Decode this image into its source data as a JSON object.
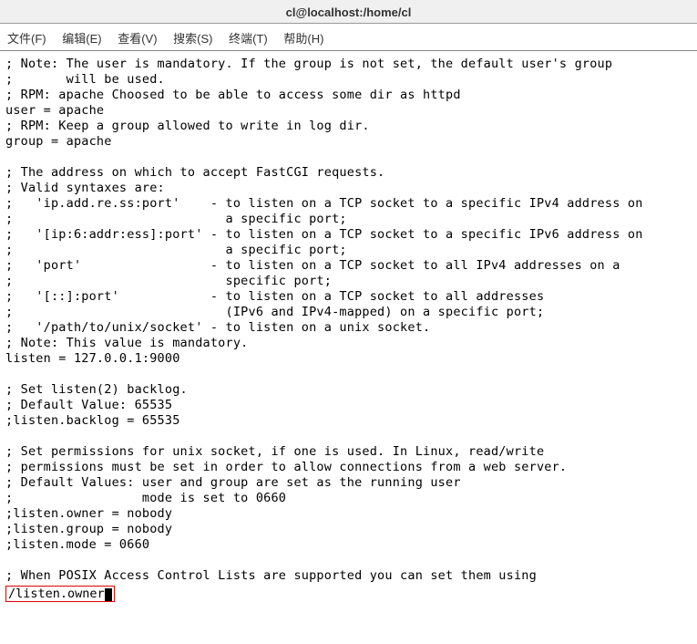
{
  "window": {
    "title": "cl@localhost:/home/cl"
  },
  "menubar": {
    "file": "文件(F)",
    "edit": "编辑(E)",
    "view": "查看(V)",
    "search": "搜索(S)",
    "terminal": "终端(T)",
    "help": "帮助(H)"
  },
  "terminal": {
    "content": "; Note: The user is mandatory. If the group is not set, the default user's group\n;       will be used.\n; RPM: apache Choosed to be able to access some dir as httpd\nuser = apache\n; RPM: Keep a group allowed to write in log dir.\ngroup = apache\n\n; The address on which to accept FastCGI requests.\n; Valid syntaxes are:\n;   'ip.add.re.ss:port'    - to listen on a TCP socket to a specific IPv4 address on\n;                            a specific port;\n;   '[ip:6:addr:ess]:port' - to listen on a TCP socket to a specific IPv6 address on\n;                            a specific port;\n;   'port'                 - to listen on a TCP socket to all IPv4 addresses on a\n;                            specific port;\n;   '[::]:port'            - to listen on a TCP socket to all addresses\n;                            (IPv6 and IPv4-mapped) on a specific port;\n;   '/path/to/unix/socket' - to listen on a unix socket.\n; Note: This value is mandatory.\nlisten = 127.0.0.1:9000\n\n; Set listen(2) backlog.\n; Default Value: 65535\n;listen.backlog = 65535\n\n; Set permissions for unix socket, if one is used. In Linux, read/write\n; permissions must be set in order to allow connections from a web server.\n; Default Values: user and group are set as the running user\n;                 mode is set to 0660\n;listen.owner = nobody\n;listen.group = nobody\n;listen.mode = 0660\n\n; When POSIX Access Control Lists are supported you can set them using"
  },
  "command": {
    "text": "/listen.owner"
  }
}
